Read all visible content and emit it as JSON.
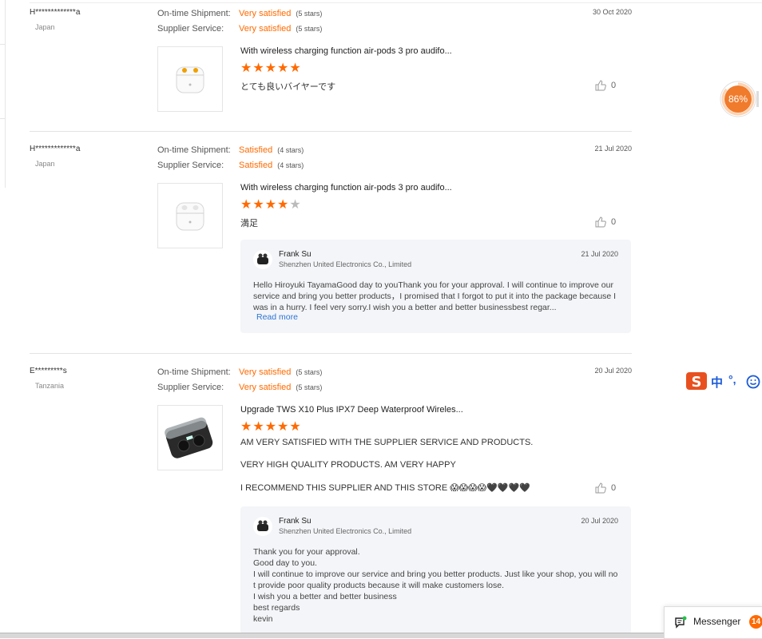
{
  "reviews": [
    {
      "user": "H*************a",
      "country": "Japan",
      "date": "30 Oct 2020",
      "shipment": {
        "label": "On-time Shipment:",
        "level": "Very satisfied",
        "count": "(5 stars)"
      },
      "service": {
        "label": "Supplier Service:",
        "level": "Very satisfied",
        "count": "(5 stars)"
      },
      "product_title": "With wireless charging function air-pods 3 pro audifo...",
      "stars": 5,
      "comment": "とても良いバイヤーです",
      "likes": "0"
    },
    {
      "user": "H*************a",
      "country": "Japan",
      "date": "21 Jul 2020",
      "shipment": {
        "label": "On-time Shipment:",
        "level": "Satisfied",
        "count": "(4 stars)"
      },
      "service": {
        "label": "Supplier Service:",
        "level": "Satisfied",
        "count": "(4 stars)"
      },
      "product_title": "With wireless charging function air-pods 3 pro audifo...",
      "stars": 4,
      "comment": "満足",
      "likes": "0",
      "reply": {
        "name": "Frank Su",
        "company": "Shenzhen United Electronics Co., Limited",
        "date": "21 Jul 2020",
        "text": "Hello Hiroyuki TayamaGood day to youThank you for your approval. I will continue to improve our service and bring you better products，I promised that I forgot to put it into the package because I was in a hurry. I feel very sorry.I wish you a better and better businessbest regar...",
        "read_more": "Read more"
      }
    },
    {
      "user": "E*********s",
      "country": "Tanzania",
      "date": "20 Jul 2020",
      "shipment": {
        "label": "On-time Shipment:",
        "level": "Very satisfied",
        "count": "(5 stars)"
      },
      "service": {
        "label": "Supplier Service:",
        "level": "Very satisfied",
        "count": "(5 stars)"
      },
      "product_title": "Upgrade TWS X10 Plus IPX7 Deep Waterproof Wireles...",
      "stars": 5,
      "comment_lines": [
        "AM VERY SATISFIED WITH THE SUPPLIER SERVICE AND PRODUCTS.",
        "VERY HIGH QUALITY PRODUCTS. AM VERY HAPPY",
        "I RECOMMEND THIS SUPPLIER AND THIS STORE 😱😱😱😱🖤🖤🖤🖤"
      ],
      "likes": "0",
      "reply": {
        "name": "Frank Su",
        "company": "Shenzhen United Electronics Co., Limited",
        "date": "20 Jul 2020",
        "text": "Thank you for your approval.\nGood day to you.\nI will continue to improve our service and bring you better products. Just like your shop, you will not provide poor quality products because it will make customers lose.\nI wish you a better and better business\nbest regards\nkevin"
      }
    }
  ],
  "widgets": {
    "progress_badge": "86%",
    "progress_value": 86,
    "ime_chinese": "中",
    "ime_punct": "°,",
    "messenger_label": "Messenger",
    "messenger_count": "14"
  },
  "colors": {
    "accent": "#ff6a00",
    "link": "#2d74d6",
    "reply_bg": "#f3f5f8"
  },
  "icons": [
    "thumbs-up-icon",
    "messenger-icon",
    "sogou-logo-icon",
    "smiley-icon"
  ]
}
